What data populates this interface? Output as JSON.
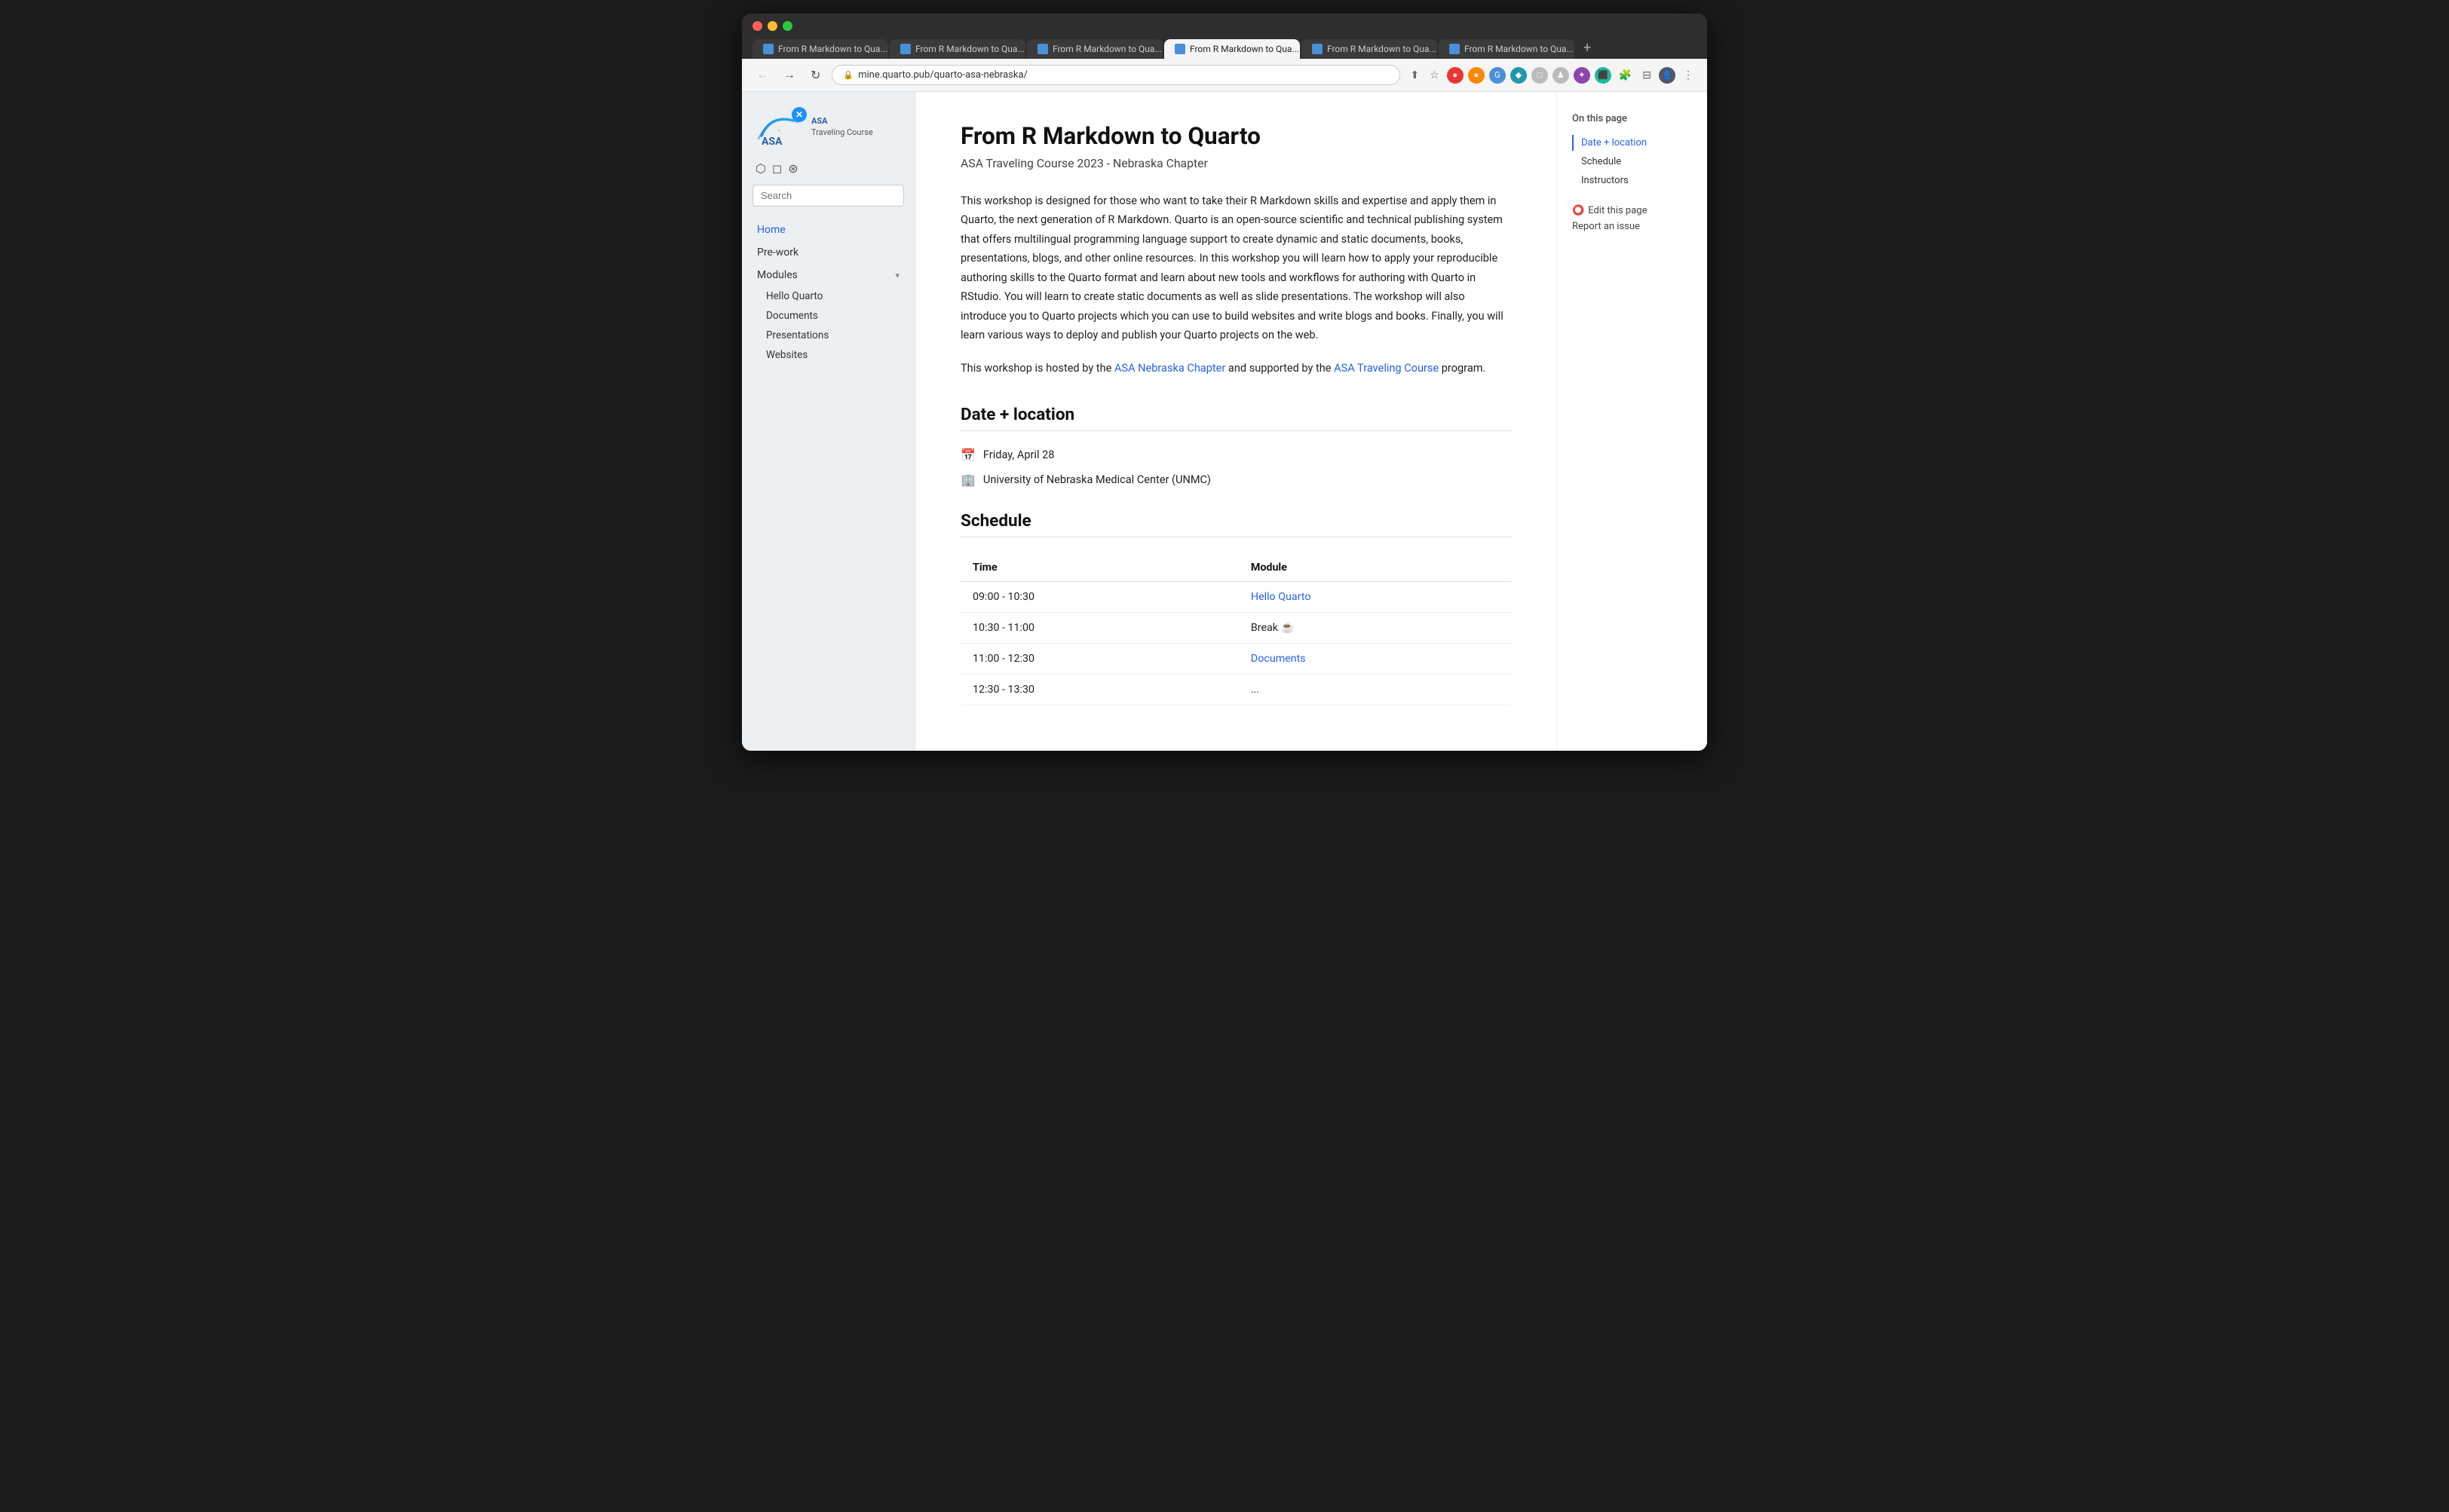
{
  "browser": {
    "dots": [
      "red",
      "yellow",
      "green"
    ],
    "tabs": [
      {
        "label": "From R Markdown to Qua...",
        "active": false
      },
      {
        "label": "From R Markdown to Qua...",
        "active": false
      },
      {
        "label": "From R Markdown to Qua...",
        "active": false
      },
      {
        "label": "From R Markdown to Qua...",
        "active": true
      },
      {
        "label": "From R Markdown to Qua...",
        "active": false
      },
      {
        "label": "From R Markdown to Qua...",
        "active": false
      }
    ],
    "address": "mine.quarto.pub/quarto-asa-nebraska/"
  },
  "sidebar": {
    "logo_alt": "ASA Traveling Course logo",
    "logo_label": "ASA\nTraveling Course",
    "search_placeholder": "Search",
    "nav_items": [
      {
        "label": "Home",
        "active": true,
        "indent": false
      },
      {
        "label": "Pre-work",
        "active": false,
        "indent": false
      },
      {
        "label": "Modules",
        "active": false,
        "indent": false,
        "has_chevron": true
      },
      {
        "label": "Hello Quarto",
        "active": false,
        "indent": true
      },
      {
        "label": "Documents",
        "active": false,
        "indent": true
      },
      {
        "label": "Presentations",
        "active": false,
        "indent": true
      },
      {
        "label": "Websites",
        "active": false,
        "indent": true
      }
    ]
  },
  "page": {
    "title": "From R Markdown to Quarto",
    "subtitle": "ASA Traveling Course 2023 - Nebraska Chapter",
    "description_1": "This workshop is designed for those who want to take their R Markdown skills and expertise and apply them in Quarto, the next generation of R Markdown. Quarto is an open-source scientific and technical publishing system that offers multilingual programming language support to create dynamic and static documents, books, presentations, blogs, and other online resources. In this workshop you will learn how to apply your reproducible authoring skills to the Quarto format and learn about new tools and workflows for authoring with Quarto in RStudio. You will learn to create static documents as well as slide presentations. The workshop will also introduce you to Quarto projects which you can use to build websites and write blogs and books. Finally, you will learn various ways to deploy and publish your Quarto projects on the web.",
    "hosted_text_before": "This workshop is hosted by the ",
    "hosted_link_1_text": "ASA Nebraska Chapter",
    "hosted_link_1_url": "#",
    "hosted_text_middle": " and supported by the ",
    "hosted_link_2_text": "ASA Traveling Course",
    "hosted_link_2_url": "#",
    "hosted_text_after": " program.",
    "date_location_heading": "Date + location",
    "date_icon": "📅",
    "date_text": "Friday, April 28",
    "location_icon": "🏢",
    "location_text": "University of Nebraska Medical Center (UNMC)",
    "schedule_heading": "Schedule",
    "schedule_cols": [
      "Time",
      "Module"
    ],
    "schedule_rows": [
      {
        "time": "09:00 - 10:30",
        "module": "Hello Quarto",
        "module_link": true
      },
      {
        "time": "10:30 - 11:00",
        "module": "Break ☕",
        "module_link": false
      },
      {
        "time": "11:00 - 12:30",
        "module": "Documents",
        "module_link": true
      },
      {
        "time": "12:30 - 13:30",
        "module": "...",
        "module_link": false
      }
    ]
  },
  "toc": {
    "title": "On this page",
    "items": [
      {
        "label": "Date + location",
        "active": true
      },
      {
        "label": "Schedule",
        "active": false
      },
      {
        "label": "Instructors",
        "active": false
      }
    ],
    "edit_label": "Edit this page",
    "report_label": "Report an issue"
  }
}
